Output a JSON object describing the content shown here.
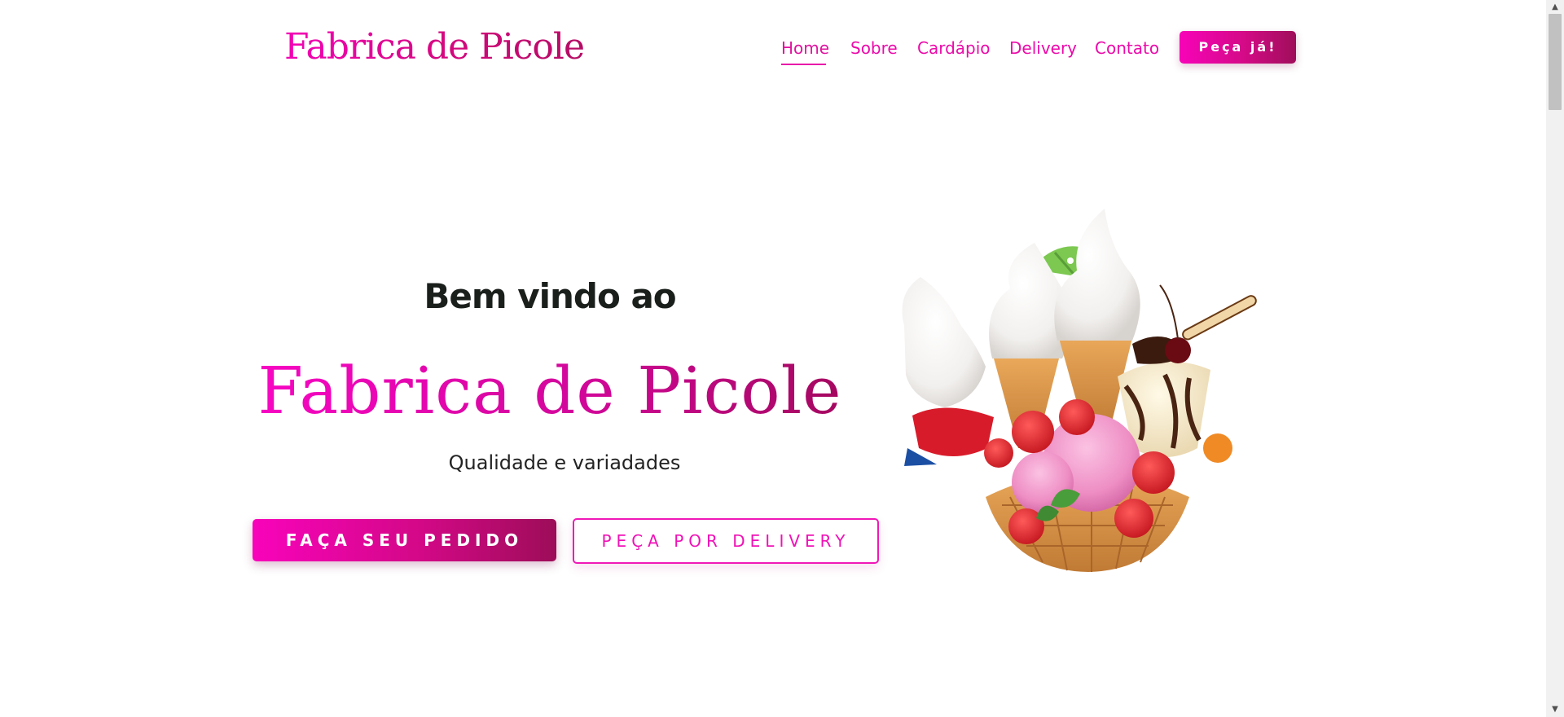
{
  "colors": {
    "brand_pink": "#ec0aaa",
    "brand_magenta": "#d40a87",
    "brand_wine": "#9d0d58",
    "text_dark": "#1a1f1c",
    "background": "#ffffff"
  },
  "header": {
    "logo": "Fabrica de Picole",
    "nav": [
      {
        "label": "Home",
        "active": true
      },
      {
        "label": "Sobre",
        "active": false
      },
      {
        "label": "Cardápio",
        "active": false
      },
      {
        "label": "Delivery",
        "active": false
      },
      {
        "label": "Contato",
        "active": false
      }
    ],
    "cta_label": "Peça já!"
  },
  "hero": {
    "kicker": "Bem vindo ao",
    "title": "Fabrica de Picole",
    "tagline": "Qualidade e variadades",
    "primary_button": "FAÇA SEU PEDIDO",
    "secondary_button": "PEÇA POR DELIVERY",
    "image_subject": "ice-cream-illustration"
  },
  "scrollbar": {
    "up_icon": "arrow-up-icon",
    "down_icon": "arrow-down-icon",
    "position_fraction": 0
  }
}
